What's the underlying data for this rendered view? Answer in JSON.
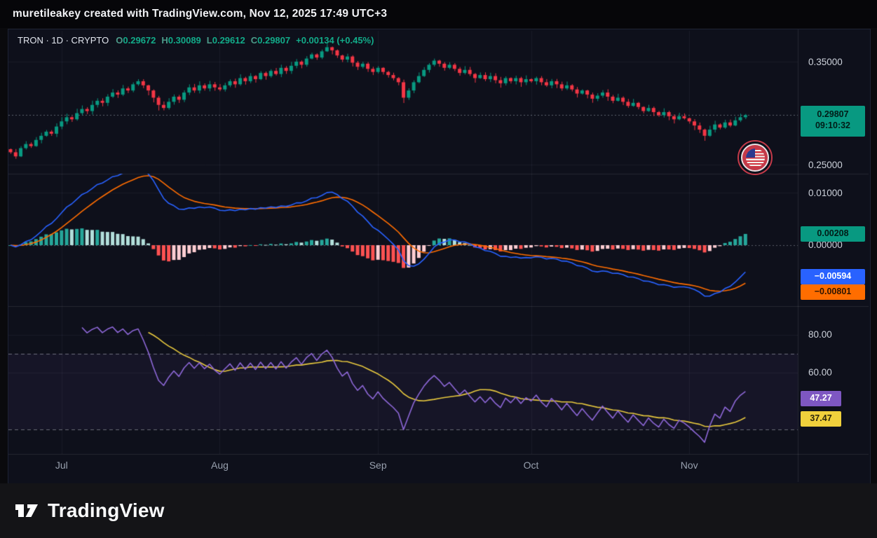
{
  "watermark": "muretileakey created with TradingView.com, Nov 12, 2025 17:49 UTC+3",
  "header": {
    "symbol_line": "TRON · 1D · CRYPTO",
    "o_label": "O",
    "o": "0.29672",
    "h_label": "H",
    "h": "0.30089",
    "l_label": "L",
    "l": "0.29612",
    "c_label": "C",
    "c": "0.29807",
    "change": "+0.00134 (+0.45%)"
  },
  "price_axis": {
    "tick_top": "0.35000",
    "tick_bottom": "0.25000",
    "last_price": "0.29807",
    "countdown": "09:10:32"
  },
  "macd_axis": {
    "tick_top": "0.01000",
    "tick_zero": "0.00000",
    "hist_value": "0.00208",
    "macd_value": "−0.00594",
    "signal_value": "−0.00801"
  },
  "rsi_axis": {
    "tick_80": "80.00",
    "tick_60": "60.00",
    "rsi_value": "47.27",
    "ma_value": "37.47"
  },
  "time_axis": {
    "months": [
      "Jul",
      "Aug",
      "Sep",
      "Oct",
      "Nov"
    ]
  },
  "branding": {
    "logo_text": "TradingView"
  },
  "colors": {
    "background": "#0e101b",
    "up": "#089981",
    "down": "#f23645",
    "macd_line": "#2962ff",
    "signal_line": "#ff6d00",
    "hist_up": "#26a69a",
    "hist_up_weak": "#b2dfdb",
    "hist_down": "#ff5252",
    "hist_down_weak": "#ffcdd2",
    "rsi_line": "#8e68d8",
    "rsi_ma_line": "#e8c93e",
    "price_badge": "#089981",
    "hist_badge": "#089981",
    "macd_badge": "#2962ff",
    "signal_badge": "#ff6d00",
    "rsi_badge": "#7e57c2",
    "rsi_ma_badge": "#f0d03c"
  },
  "chart_data": [
    {
      "type": "candlestick",
      "title": "TRON · 1D · CRYPTO",
      "last_ohlc": {
        "open": 0.29672,
        "high": 0.30089,
        "low": 0.29612,
        "close": 0.29807,
        "change_abs": 0.00134,
        "change_pct": 0.45
      },
      "ylim": [
        0.2405,
        0.3795
      ],
      "yticks": [
        0.25,
        0.35
      ],
      "month_tick_labels": [
        "Jul",
        "Aug",
        "Sep",
        "Oct",
        "Nov"
      ],
      "month_tick_indices": [
        10,
        41,
        72,
        102,
        133
      ],
      "closes": [
        0.262,
        0.258,
        0.266,
        0.27,
        0.268,
        0.274,
        0.278,
        0.282,
        0.28,
        0.287,
        0.292,
        0.296,
        0.294,
        0.3,
        0.304,
        0.302,
        0.308,
        0.312,
        0.31,
        0.316,
        0.32,
        0.318,
        0.324,
        0.322,
        0.328,
        0.331,
        0.327,
        0.322,
        0.315,
        0.308,
        0.305,
        0.311,
        0.316,
        0.313,
        0.32,
        0.325,
        0.322,
        0.327,
        0.324,
        0.328,
        0.325,
        0.323,
        0.327,
        0.331,
        0.328,
        0.334,
        0.331,
        0.336,
        0.333,
        0.339,
        0.336,
        0.341,
        0.338,
        0.344,
        0.341,
        0.346,
        0.35,
        0.347,
        0.353,
        0.357,
        0.354,
        0.36,
        0.364,
        0.361,
        0.356,
        0.352,
        0.355,
        0.349,
        0.345,
        0.348,
        0.343,
        0.34,
        0.344,
        0.34,
        0.337,
        0.334,
        0.33,
        0.315,
        0.322,
        0.33,
        0.336,
        0.342,
        0.347,
        0.351,
        0.348,
        0.344,
        0.347,
        0.343,
        0.339,
        0.342,
        0.338,
        0.334,
        0.337,
        0.333,
        0.336,
        0.332,
        0.329,
        0.334,
        0.331,
        0.334,
        0.33,
        0.333,
        0.331,
        0.334,
        0.33,
        0.327,
        0.331,
        0.328,
        0.324,
        0.327,
        0.323,
        0.319,
        0.322,
        0.318,
        0.314,
        0.317,
        0.32,
        0.316,
        0.312,
        0.315,
        0.311,
        0.307,
        0.31,
        0.306,
        0.302,
        0.305,
        0.301,
        0.298,
        0.301,
        0.297,
        0.294,
        0.297,
        0.295,
        0.292,
        0.288,
        0.284,
        0.278,
        0.284,
        0.289,
        0.286,
        0.291,
        0.288,
        0.293,
        0.296,
        0.29807
      ]
    },
    {
      "type": "macd",
      "params": {
        "fast": 12,
        "slow": 26,
        "signal": 9
      },
      "last": {
        "macd": -0.00594,
        "signal": -0.00801,
        "hist": 0.00208
      },
      "ylim": [
        -0.0116,
        0.0136
      ],
      "yticks": [
        0,
        0.01
      ],
      "derived_from": "closes of candlestick pane"
    },
    {
      "type": "rsi",
      "period": 14,
      "bands": [
        70,
        30
      ],
      "last": {
        "rsi": 47.27,
        "ma": 37.47
      },
      "ylim": [
        17,
        95
      ],
      "yticks": [
        60,
        80
      ],
      "derived_from": "closes of candlestick pane"
    }
  ]
}
